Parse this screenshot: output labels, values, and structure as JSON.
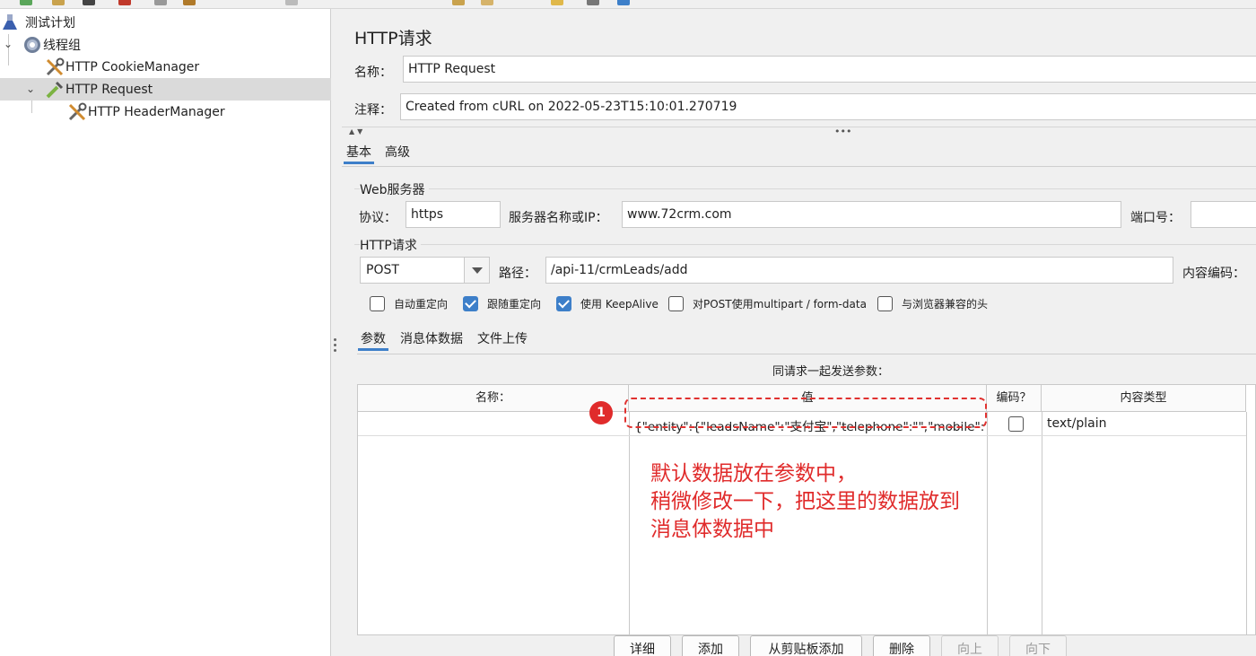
{
  "tree": {
    "items": [
      {
        "label": "测试计划",
        "icon": "flask-icon"
      },
      {
        "label": "线程组",
        "icon": "gear-icon"
      },
      {
        "label": "HTTP CookieManager",
        "icon": "wrench-icon"
      },
      {
        "label": "HTTP Request",
        "icon": "pipette-icon"
      },
      {
        "label": "HTTP HeaderManager",
        "icon": "wrench-icon"
      }
    ],
    "selected_index": 3
  },
  "panel": {
    "title": "HTTP请求",
    "name_label": "名称：",
    "name_value": "HTTP Request",
    "comment_label": "注释：",
    "comment_value": "Created from cURL on 2022-05-23T15:10:01.270719"
  },
  "tabs": {
    "basic": "基本",
    "advanced": "高级",
    "active": "基本"
  },
  "web_server": {
    "section_title": "Web服务器",
    "protocol_label": "协议：",
    "protocol_value": "https",
    "server_label": "服务器名称或IP：",
    "server_value": "www.72crm.com",
    "port_label": "端口号："
  },
  "http_request": {
    "section_title": "HTTP请求",
    "method_value": "POST",
    "path_label": "路径：",
    "path_value": "/api-11/crmLeads/add",
    "encoding_label": "内容编码："
  },
  "options": [
    {
      "label": "自动重定向",
      "checked": false
    },
    {
      "label": "跟随重定向",
      "checked": true
    },
    {
      "label": "使用 KeepAlive",
      "checked": true
    },
    {
      "label": "对POST使用multipart / form-data",
      "checked": false
    },
    {
      "label": "与浏览器兼容的头",
      "checked": false
    }
  ],
  "sub_tabs": {
    "params": "参数",
    "body": "消息体数据",
    "files": "文件上传",
    "active": "参数"
  },
  "params_table": {
    "caption": "同请求一起发送参数：",
    "headers": [
      "名称：",
      "值",
      "编码？",
      "内容类型"
    ],
    "rows": [
      {
        "name": "",
        "value": "{\"entity\":{\"leadsName\":\"支付宝\",\"telephone\":\"\",\"mobile\":\"\"...",
        "encode": false,
        "content_type": "text/plain"
      }
    ]
  },
  "annotation": {
    "badge": "1",
    "lines": [
      "默认数据放在参数中，",
      "稍微修改一下，把这里的数据放到",
      "消息体数据中"
    ],
    "color": "#e02b2b"
  },
  "buttons": {
    "detail": "详细",
    "add": "添加",
    "add_clipboard": "从剪贴板添加",
    "delete": "删除",
    "up": "向上",
    "down": "向下"
  },
  "colors": {
    "accent": "#3d7fc9",
    "selected_row": "#dadada"
  }
}
